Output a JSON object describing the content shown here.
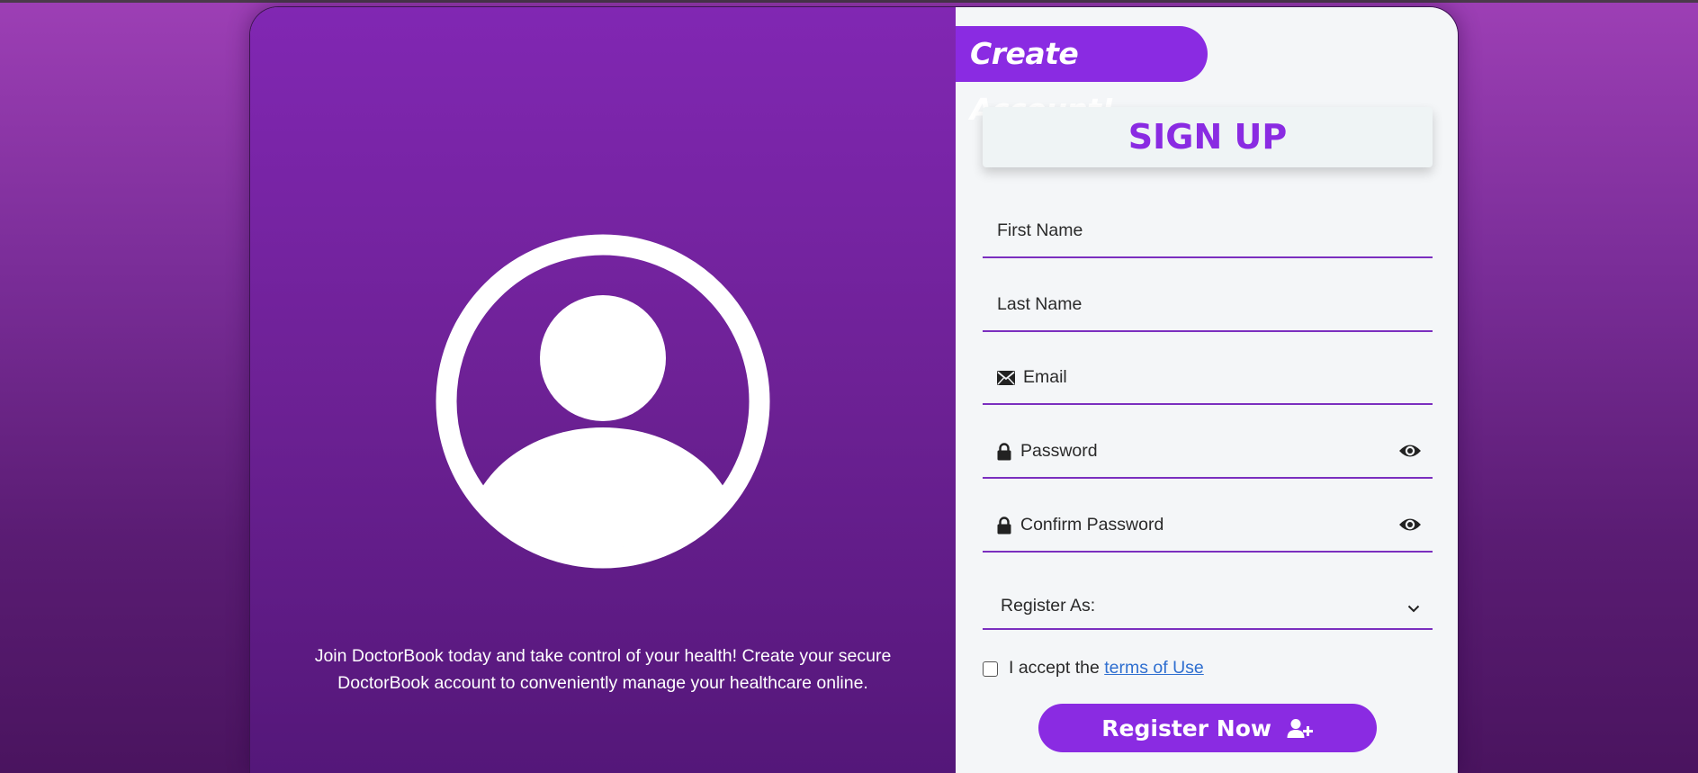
{
  "left_panel": {
    "avatar_icon": "user-circle-icon",
    "blurb_line1": "Join DoctorBook today and take control of your health! Create your secure",
    "blurb_line2": "DoctorBook account to conveniently manage your healthcare online."
  },
  "form": {
    "tag": "Create Account!",
    "heading": "SIGN UP",
    "first_name_placeholder": "First Name",
    "last_name_placeholder": "Last Name",
    "email_placeholder": "Email",
    "password_placeholder": "Password",
    "confirm_password_placeholder": "Confirm Password",
    "register_as_label": "Register As:",
    "terms_prefix": "I accept the ",
    "terms_link": "terms of Use",
    "submit_label": "Register Now"
  },
  "colors": {
    "accent": "#8a2be2",
    "panel_top": "#8127b3",
    "panel_bottom": "#541779",
    "link": "#2f6fd0"
  }
}
